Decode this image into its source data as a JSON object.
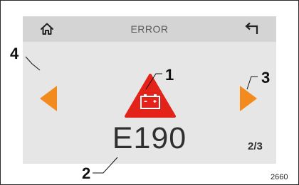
{
  "header": {
    "title": "ERROR",
    "home_icon": "home-icon",
    "back_icon": "back-return-icon"
  },
  "error": {
    "icon": "battery-warning-icon",
    "icon_color": "#e32219",
    "code": "E190"
  },
  "navigation": {
    "prev_icon": "left-arrow-icon",
    "next_icon": "right-arrow-icon",
    "arrow_color": "#f28a1e",
    "page": "2/3"
  },
  "callouts": [
    "1",
    "2",
    "3",
    "4"
  ],
  "figure_ref": "2660"
}
